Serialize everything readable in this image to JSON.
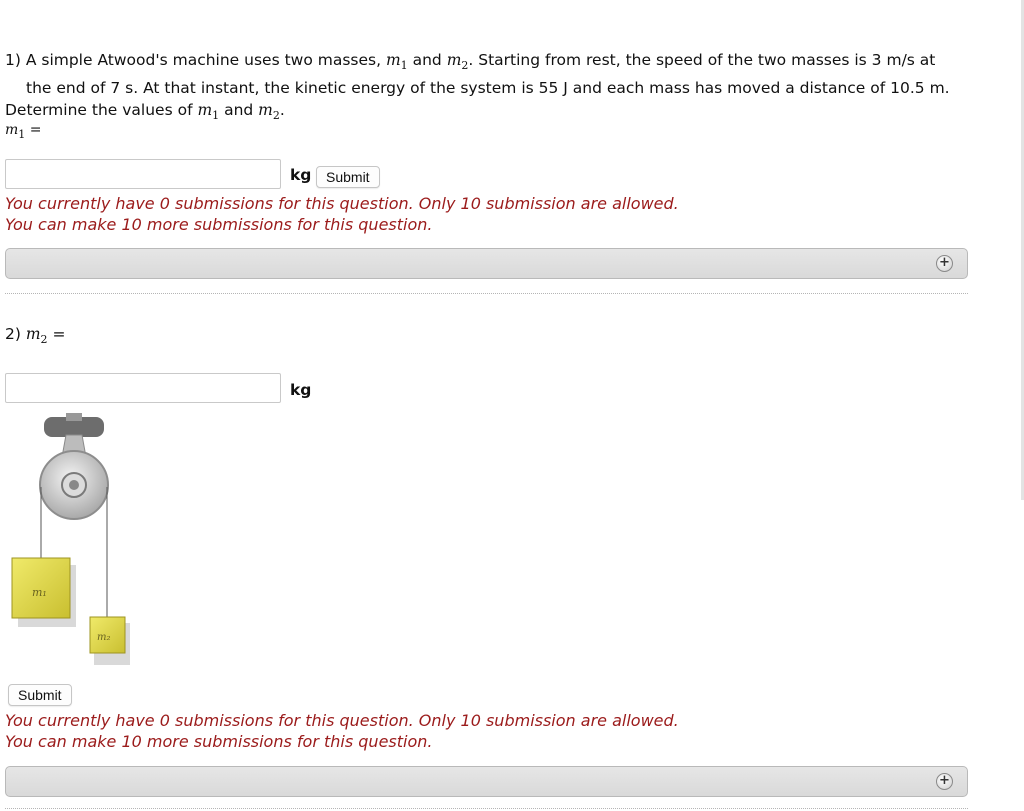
{
  "question1": {
    "line1": "1) A simple Atwood's machine uses two masses, ",
    "m1": "m",
    "m1_sub": "1",
    "and": " and ",
    "m2": "m",
    "m2_sub": "2",
    "line1_end": ". Starting from rest, the speed of the two masses is 3 m/s at",
    "line2": "the end of 7 s. At that instant, the kinetic energy of the system is 55 J and each mass has moved a distance of 10.5 m.",
    "line3_start": "Determine the values of ",
    "line3_mid": " and ",
    "line3_end": ".",
    "prompt_var": "m",
    "prompt_sub": "1",
    "prompt_eq": " =",
    "input_value": "",
    "unit": "kg",
    "submit_label": "Submit",
    "notice_line1": "You currently have 0 submissions for this question. Only 10 submission are allowed.",
    "notice_line2": "You can make 10 more submissions for this question."
  },
  "question2": {
    "prefix": "2) ",
    "prompt_var": "m",
    "prompt_sub": "2",
    "prompt_eq": " =",
    "input_value": "",
    "unit": "kg",
    "figure_label_m1": "m₁",
    "figure_label_m2": "m₂",
    "submit_label": "Submit",
    "notice_line1": "You currently have 0 submissions for this question. Only 10 submission are allowed.",
    "notice_line2": "You can make 10 more submissions for this question."
  },
  "icons": {
    "expand": "plus-circle-icon",
    "expand_glyph": "+"
  },
  "colors": {
    "notice": "#9b1b1b",
    "hint_bar": "#dedede"
  }
}
